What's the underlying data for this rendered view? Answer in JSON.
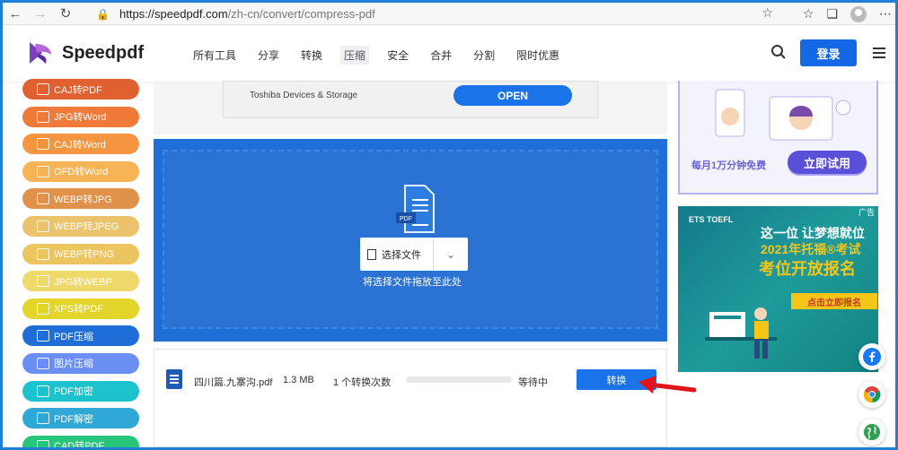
{
  "browser": {
    "url_host": "https://speedpdf.com",
    "url_path": "/zh-cn/convert/compress-pdf"
  },
  "site": {
    "logo_text": "Speedpdf",
    "nav": [
      "所有工具",
      "分享",
      "转换",
      "压缩",
      "安全",
      "合并",
      "分割",
      "限时优惠"
    ],
    "active_nav": "压缩",
    "login_label": "登录"
  },
  "sidebar": {
    "items": [
      {
        "label": "CAJ转PDF",
        "color": "#e0602f"
      },
      {
        "label": "JPG转Word",
        "color": "#f07a3a"
      },
      {
        "label": "CAJ转Word",
        "color": "#f59540"
      },
      {
        "label": "OFD转Word",
        "color": "#f7b456"
      },
      {
        "label": "WEBP转JPG",
        "color": "#e0914a"
      },
      {
        "label": "WEBP转JPEG",
        "color": "#ebc36c"
      },
      {
        "label": "WEBP转PNG",
        "color": "#edc55e"
      },
      {
        "label": "JPG转WEBP",
        "color": "#eed96a"
      },
      {
        "label": "XPS转PDF",
        "color": "#e3d52a"
      },
      {
        "label": "PDF压缩",
        "color": "#1f6ed8"
      },
      {
        "label": "图片压缩",
        "color": "#6b8ef5"
      },
      {
        "label": "PDF加密",
        "color": "#1cc2cc"
      },
      {
        "label": "PDF解密",
        "color": "#2fa7d7"
      },
      {
        "label": "CAD转PDF",
        "color": "#28c67a"
      }
    ]
  },
  "ad_banner": {
    "company": "Toshiba Devices & Storage",
    "button": "OPEN"
  },
  "upload": {
    "file_badge": "PDF",
    "select_label": "选择文件",
    "drop_hint": "将选择文件拖放至此处"
  },
  "file_row": {
    "name": "四川篇.九寨沟.pdf",
    "size": "1.3 MB",
    "count": "1 个转换次数",
    "progress": 0,
    "status": "等待中",
    "convert_label": "转换"
  },
  "right_ads": {
    "ad1_text": "每月1万分钟免费",
    "ad1_button": "立即试用",
    "ad2_logo": "ETS TOEFL",
    "ad2_badge": "广告",
    "ad2_line1": "这一位 让梦想就位",
    "ad2_line2": "2021年托福®考试",
    "ad2_line3": "考位开放报名",
    "ad2_cta": "点击立即报名"
  }
}
